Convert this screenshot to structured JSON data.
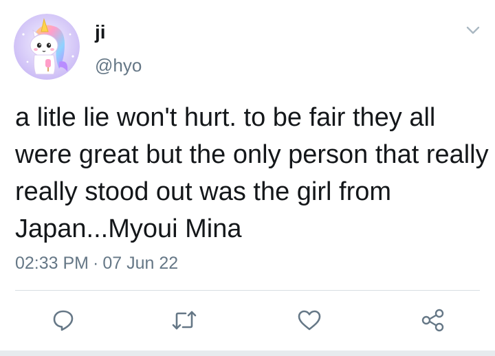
{
  "user": {
    "display_name": "ji",
    "handle": "@hyo",
    "avatar_icon": "unicorn-avatar-icon"
  },
  "tweet": {
    "text": "a litle lie won't hurt. to be fair they all were great but the only person that really really stood out was the girl from Japan...Myoui Mina",
    "time": "02:33 PM",
    "separator": "·",
    "date": "07 Jun 22"
  },
  "actions": {
    "reply_icon": "reply-icon",
    "retweet_icon": "retweet-icon",
    "like_icon": "heart-icon",
    "share_icon": "share-icon"
  },
  "colors": {
    "text_primary": "#14171a",
    "text_secondary": "#657786",
    "divider": "#d8dde2",
    "icon": "#657786"
  }
}
